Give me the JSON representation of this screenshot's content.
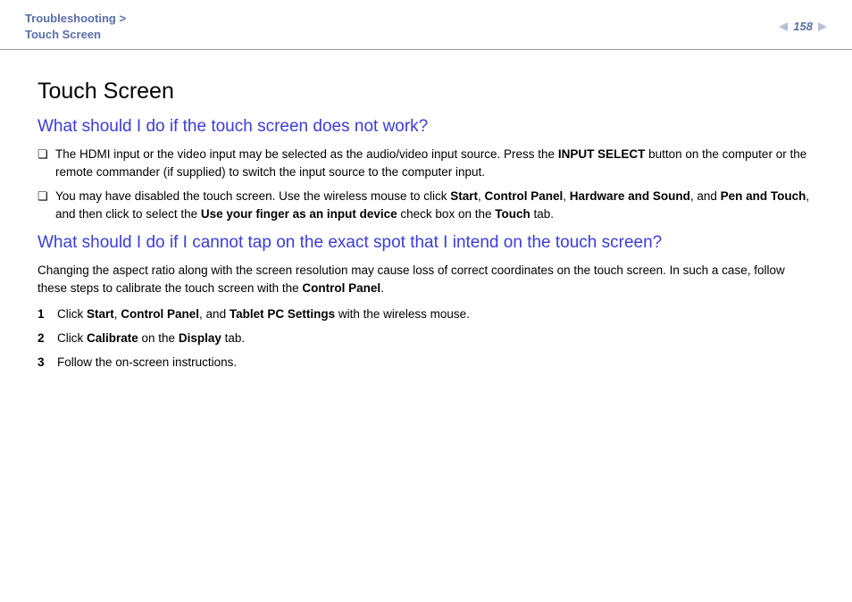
{
  "header": {
    "breadcrumb_parent": "Troubleshooting",
    "breadcrumb_sep": " > ",
    "breadcrumb_current": "Touch Screen",
    "page_number": "158"
  },
  "title": "Touch Screen",
  "q1": {
    "heading": "What should I do if the touch screen does not work?",
    "bullets": [
      {
        "pre": "The HDMI input or the video input may be selected as the audio/video input source. Press the ",
        "b1": "INPUT SELECT",
        "post": " button on the computer or the remote commander (if supplied) to switch the input source to the computer input."
      },
      {
        "pre": "You may have disabled the touch screen. Use the wireless mouse to click ",
        "b1": "Start",
        "s1": ", ",
        "b2": "Control Panel",
        "s2": ", ",
        "b3": "Hardware and Sound",
        "s3": ", and ",
        "b4": "Pen and Touch",
        "s4": ", and then click to select the ",
        "b5": "Use your finger as an input device",
        "s5": " check box on the ",
        "b6": "Touch",
        "post": " tab."
      }
    ]
  },
  "q2": {
    "heading": "What should I do if I cannot tap on the exact spot that I intend on the touch screen?",
    "intro_pre": "Changing the aspect ratio along with the screen resolution may cause loss of correct coordinates on the touch screen. In such a case, follow these steps to calibrate the touch screen with the ",
    "intro_b": "Control Panel",
    "intro_post": ".",
    "steps": [
      {
        "num": "1",
        "pre": "Click ",
        "b1": "Start",
        "s1": ", ",
        "b2": "Control Panel",
        "s2": ", and ",
        "b3": "Tablet PC Settings",
        "post": " with the wireless mouse."
      },
      {
        "num": "2",
        "pre": "Click ",
        "b1": "Calibrate",
        "s1": " on the ",
        "b2": "Display",
        "post": " tab."
      },
      {
        "num": "3",
        "pre": "Follow the on-screen instructions."
      }
    ]
  }
}
